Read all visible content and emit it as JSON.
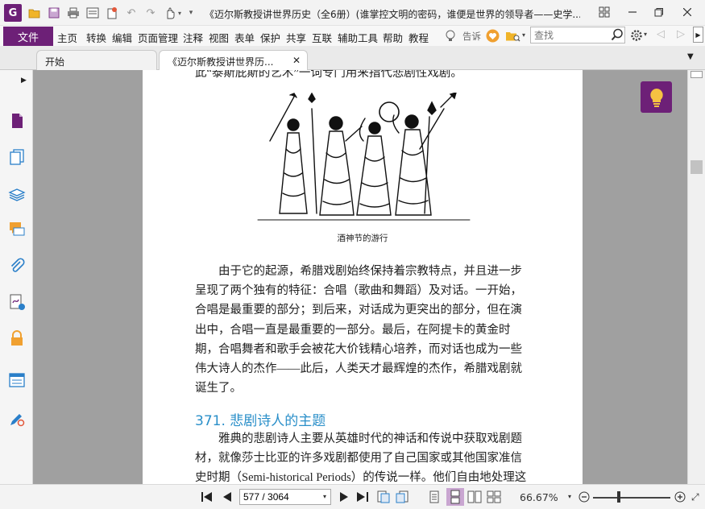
{
  "titlebar": {
    "app_logo": "G",
    "title": "《迈尔斯教授讲世界历史（全6册）(谁掌控文明的密码，谁便是世界的领导者——史学..."
  },
  "menubar": {
    "file": "文件",
    "items": [
      "主页",
      "转换",
      "编辑",
      "页面管理",
      "注释",
      "视图",
      "表单",
      "保护",
      "共享",
      "互联",
      "辅助工具",
      "帮助",
      "教程"
    ],
    "tell_me": "告诉",
    "search_placeholder": "查找"
  },
  "tabs": [
    {
      "label": "开始",
      "active": false
    },
    {
      "label": "《迈尔斯教授讲世界历...",
      "active": true
    }
  ],
  "page": {
    "top_line": "此“泰斯庇斯的艺术”一词专门用来指代悲剧性戏剧。",
    "caption": "酒神节的游行",
    "paragraph1": [
      "　　由于它的起源，希腊戏剧始终保持着宗教特点，并且进一步",
      "呈现了两个独有的特征：合唱（歌曲和舞蹈）及对话。一开始，",
      "合唱是最重要的部分；到后来，对话成为更突出的部分，但在演",
      "出中，合唱一直是最重要的一部分。最后，在阿提卡的黄金时",
      "期，合唱舞者和歌手会被花大价钱精心培养，而对话也成为一些",
      "伟大诗人的杰作——此后，人类天才最辉煌的杰作，希腊戏剧就",
      "诞生了。"
    ],
    "section_heading": "371. 悲剧诗人的主题",
    "paragraph2": [
      "　　雅典的悲剧诗人主要从英雄时代的神话和传说中获取戏剧题",
      "材，就像莎士比亚的许多戏剧都使用了自己国家或其他国家准信",
      "史时期（Semi-historical Periods）的传说一样。他们自由地处理这"
    ]
  },
  "statusbar": {
    "page_field": "577 / 3064",
    "zoom": "66.67%",
    "zoom_fraction": 0.33
  },
  "colors": {
    "brand": "#6d2077",
    "heading": "#2a8fc9",
    "canvas": "#a0a0a0"
  }
}
